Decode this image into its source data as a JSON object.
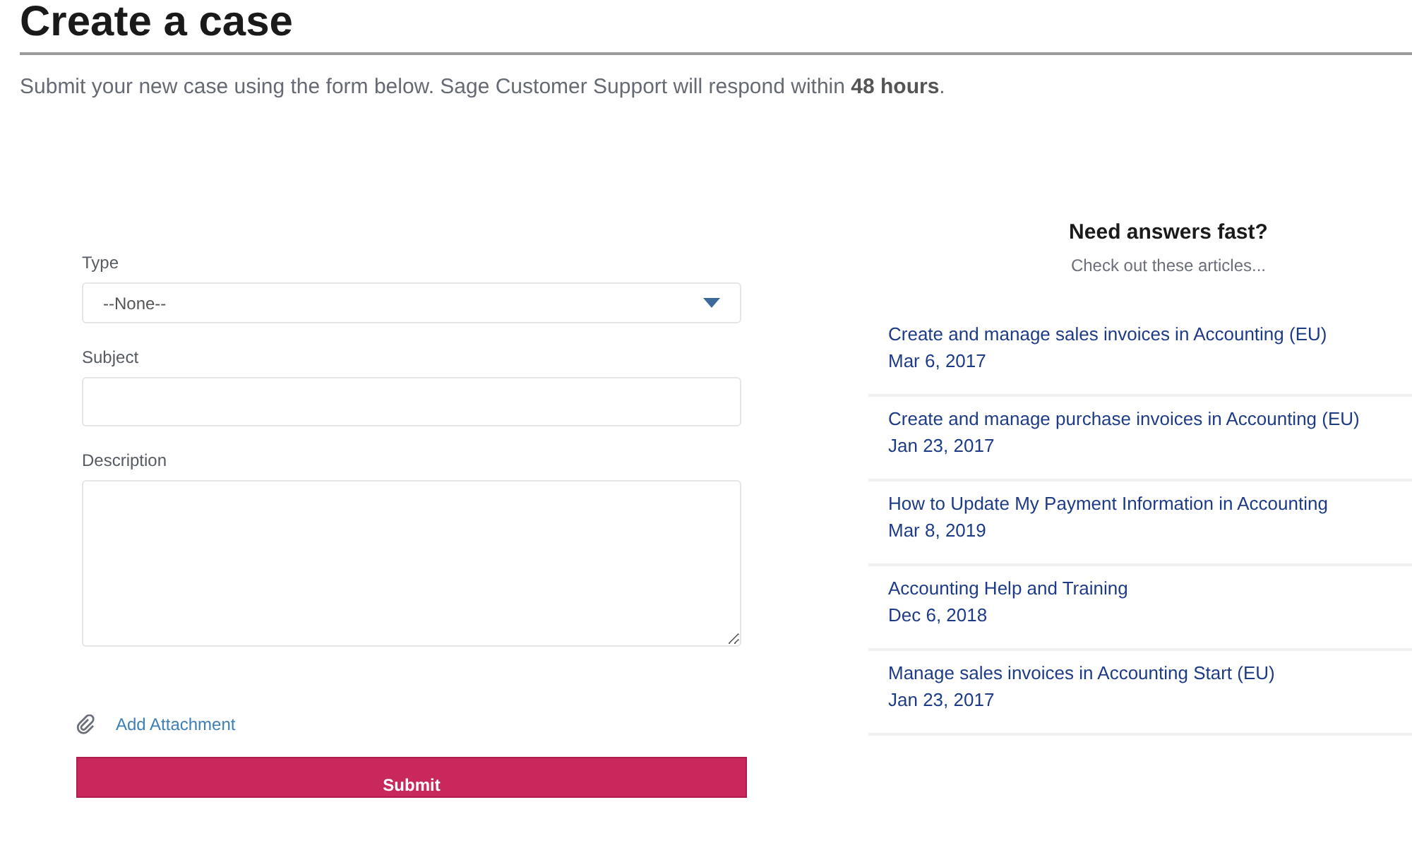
{
  "page": {
    "title": "Create a case",
    "intro": "Submit your new case using the form below. Sage Customer Support will respond within **48 hours**."
  },
  "form": {
    "fields": [
      {
        "kind": "select",
        "label": "Type",
        "value": "--None--"
      },
      {
        "kind": "text",
        "label": "Subject"
      },
      {
        "kind": "textarea",
        "label": "Description"
      }
    ],
    "attachment": "Add Attachment",
    "submit": "Submit"
  },
  "sidebar": {
    "heading": "Need answers fast?",
    "subheading": "Check out these articles...",
    "articles": [
      {
        "title": "Create and manage sales invoices in Accounting (EU)",
        "date": "Mar 6, 2017"
      },
      {
        "title": "Create and manage purchase invoices in Accounting (EU)",
        "date": "Jan 23, 2017"
      },
      {
        "title": "How to Update My Payment Information in Accounting",
        "date": "Mar 8, 2019"
      },
      {
        "title": "Accounting Help and Training",
        "date": "Dec 6, 2018"
      },
      {
        "title": "Manage sales invoices in Accounting Start (EU)",
        "date": "Jan 23, 2017"
      }
    ]
  }
}
